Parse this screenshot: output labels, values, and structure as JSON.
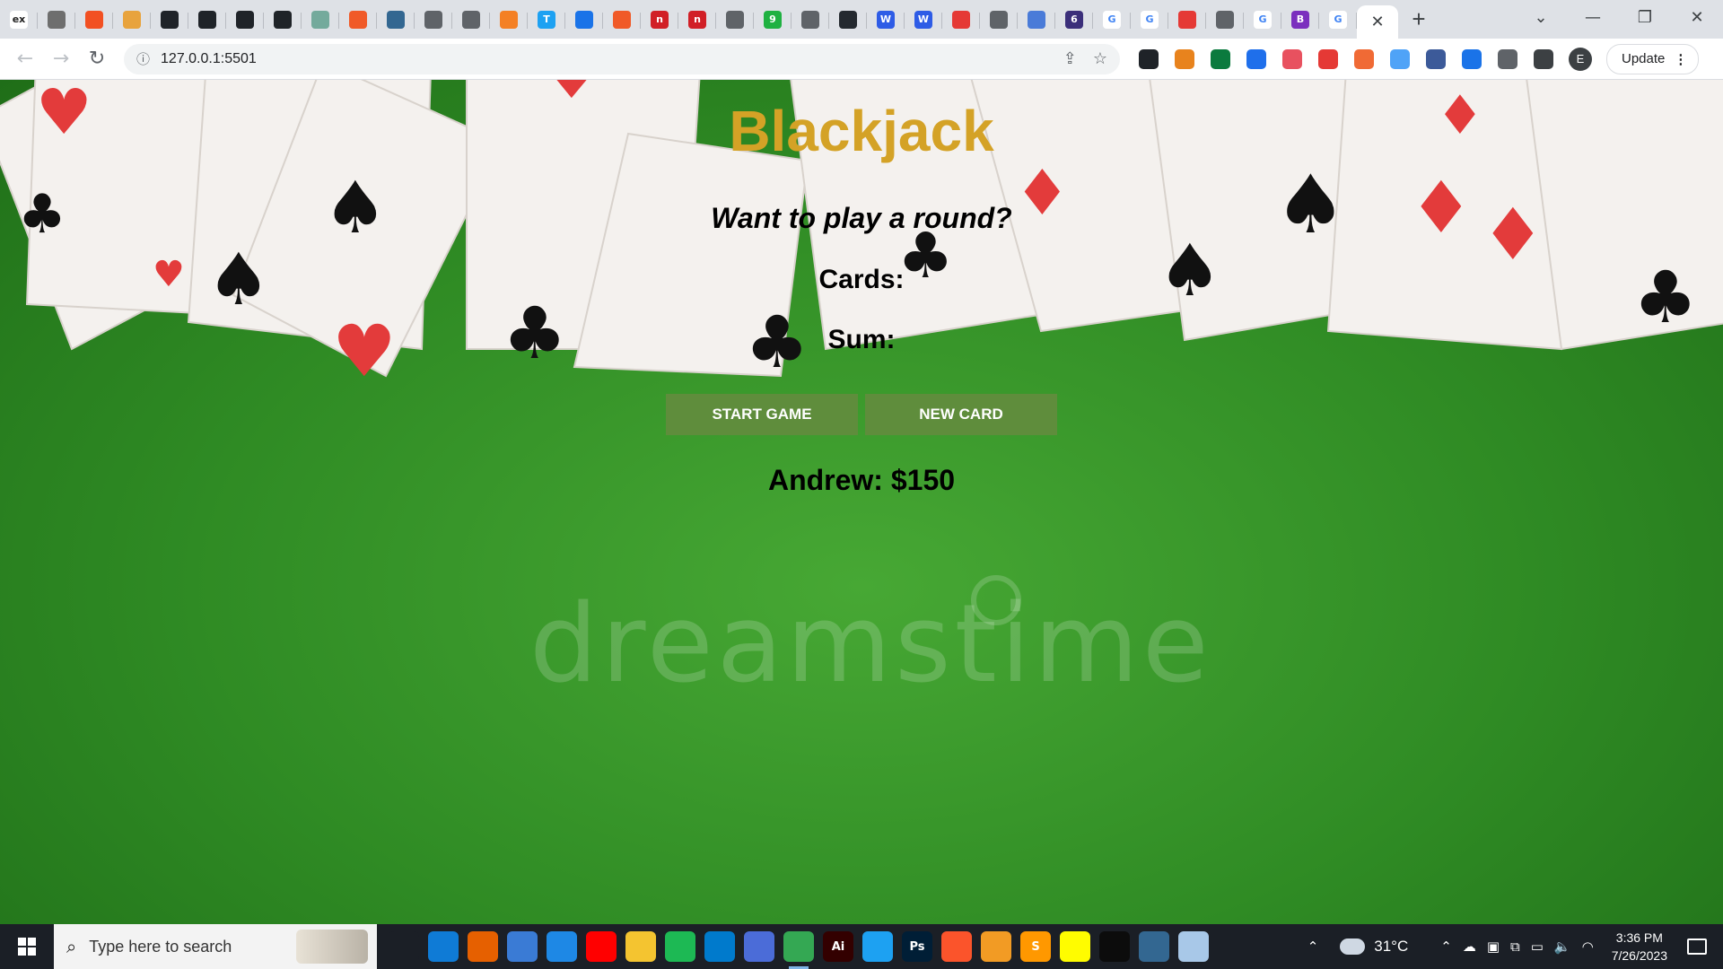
{
  "browser": {
    "tab_favicons": [
      {
        "icon": "ex-icon",
        "label": "ex",
        "color": "#ffffff",
        "text": "#222"
      },
      {
        "icon": "hexagon-icon",
        "label": "",
        "color": "#6e6e6e",
        "text": "#fff"
      },
      {
        "icon": "microsoft-icon",
        "label": "",
        "color": "#f25022",
        "text": "#fff"
      },
      {
        "icon": "fox-icon",
        "label": "",
        "color": "#e8a33d",
        "text": "#fff"
      },
      {
        "icon": "leaf-icon",
        "label": "",
        "color": "#1f2328",
        "text": "#fff"
      },
      {
        "icon": "leaf-icon",
        "label": "",
        "color": "#1f2328",
        "text": "#fff"
      },
      {
        "icon": "leaf-icon",
        "label": "",
        "color": "#1f2328",
        "text": "#fff"
      },
      {
        "icon": "leaf-icon",
        "label": "",
        "color": "#1f2328",
        "text": "#fff"
      },
      {
        "icon": "openai-icon",
        "label": "",
        "color": "#74aa9c",
        "text": "#fff"
      },
      {
        "icon": "codepen-icon",
        "label": "",
        "color": "#f05a28",
        "text": "#fff"
      },
      {
        "icon": "postgres-icon",
        "label": "",
        "color": "#336791",
        "text": "#fff"
      },
      {
        "icon": "globe-icon",
        "label": "",
        "color": "#5f6368",
        "text": "#fff"
      },
      {
        "icon": "globe-icon",
        "label": "",
        "color": "#5f6368",
        "text": "#fff"
      },
      {
        "icon": "stackoverflow-icon",
        "label": "",
        "color": "#f48024",
        "text": "#fff"
      },
      {
        "icon": "t-icon",
        "label": "T",
        "color": "#1da1f2",
        "text": "#fff"
      },
      {
        "icon": "download-icon",
        "label": "",
        "color": "#1a73e8",
        "text": "#fff"
      },
      {
        "icon": "codepen-icon",
        "label": "",
        "color": "#f05a28",
        "text": "#fff"
      },
      {
        "icon": "n-icon",
        "label": "n",
        "color": "#d11f26",
        "text": "#fff"
      },
      {
        "icon": "n-icon",
        "label": "n",
        "color": "#d11f26",
        "text": "#fff"
      },
      {
        "icon": "globe-icon",
        "label": "",
        "color": "#5f6368",
        "text": "#fff"
      },
      {
        "icon": "nine-icon",
        "label": "9",
        "color": "#1fb141",
        "text": "#fff"
      },
      {
        "icon": "globe-icon",
        "label": "",
        "color": "#5f6368",
        "text": "#fff"
      },
      {
        "icon": "github-icon",
        "label": "",
        "color": "#24292f",
        "text": "#fff"
      },
      {
        "icon": "w-icon",
        "label": "W",
        "color": "#2e5ce6",
        "text": "#fff"
      },
      {
        "icon": "w-icon",
        "label": "W",
        "color": "#2e5ce6",
        "text": "#fff"
      },
      {
        "icon": "red-app-icon",
        "label": "",
        "color": "#e53935",
        "text": "#fff"
      },
      {
        "icon": "globe-icon",
        "label": "",
        "color": "#5f6368",
        "text": "#fff"
      },
      {
        "icon": "flag-icon",
        "label": "",
        "color": "#4a7bd8",
        "text": "#fff"
      },
      {
        "icon": "six-icon",
        "label": "6",
        "color": "#3b2f7a",
        "text": "#fff"
      },
      {
        "icon": "google-icon",
        "label": "G",
        "color": "#ffffff",
        "text": "#4285f4"
      },
      {
        "icon": "google-icon",
        "label": "G",
        "color": "#ffffff",
        "text": "#4285f4"
      },
      {
        "icon": "bug-icon",
        "label": "",
        "color": "#e53935",
        "text": "#fff"
      },
      {
        "icon": "globe-icon",
        "label": "",
        "color": "#5f6368",
        "text": "#fff"
      },
      {
        "icon": "google-icon",
        "label": "G",
        "color": "#ffffff",
        "text": "#4285f4"
      },
      {
        "icon": "b-icon",
        "label": "B",
        "color": "#7b2fbe",
        "text": "#fff"
      },
      {
        "icon": "google-icon",
        "label": "G",
        "color": "#ffffff",
        "text": "#4285f4"
      }
    ],
    "active_tab_close": "✕",
    "new_tab": "+",
    "window_controls": {
      "dropdown": "⌄",
      "minimize": "—",
      "restore": "❐",
      "close": "✕"
    },
    "url": "127.0.0.1:5501",
    "update_label": "Update",
    "profile_initial": "E",
    "extensions": [
      {
        "icon": "sparkle-icon",
        "color": "#1f2328"
      },
      {
        "icon": "metamask-icon",
        "color": "#e8831d"
      },
      {
        "icon": "gear-grid-icon",
        "color": "#0b7a3e"
      },
      {
        "icon": "n-ext-icon",
        "color": "#1f6feb"
      },
      {
        "icon": "p-ext-icon",
        "color": "#e8515f"
      },
      {
        "icon": "lock-icon",
        "color": "#e53935"
      },
      {
        "icon": "a-ext-icon",
        "color": "#f06a35"
      },
      {
        "icon": "drop-icon",
        "color": "#4fa3f7"
      },
      {
        "icon": "v-ext-icon",
        "color": "#3c5a99"
      },
      {
        "icon": "circle-ext-icon",
        "color": "#1a73e8"
      },
      {
        "icon": "puzzle-icon",
        "color": "#5f6368"
      },
      {
        "icon": "sidepanel-icon",
        "color": "#3c4043"
      }
    ]
  },
  "game": {
    "title": "Blackjack",
    "message": "Want to play a round?",
    "cards_label": "Cards:",
    "sum_label": "Sum:",
    "start_button": "START GAME",
    "new_card_button": "NEW CARD",
    "player": "Andrew: $150",
    "watermark": "dreamstime",
    "title_color": "#d4a226",
    "button_color": "#5f8d3c"
  },
  "taskbar": {
    "search_placeholder": "Type here to search",
    "apps": [
      {
        "icon": "task-view-icon",
        "label": "",
        "color": "#1b1f26"
      },
      {
        "icon": "edge-icon",
        "label": "",
        "color": "#0f7bd6"
      },
      {
        "icon": "firefox-icon",
        "label": "",
        "color": "#e66000"
      },
      {
        "icon": "store-icon",
        "label": "",
        "color": "#3a7bd5"
      },
      {
        "icon": "mail-icon",
        "label": "",
        "color": "#1e88e5"
      },
      {
        "icon": "youtube-icon",
        "label": "",
        "color": "#ff0000"
      },
      {
        "icon": "folder-icon",
        "label": "",
        "color": "#f4c430"
      },
      {
        "icon": "spotify-icon",
        "label": "",
        "color": "#1db954"
      },
      {
        "icon": "vscode-icon",
        "label": "",
        "color": "#007acc"
      },
      {
        "icon": "app-icon",
        "label": "",
        "color": "#4b6cd8"
      },
      {
        "icon": "chrome-icon",
        "label": "",
        "color": "#34a853"
      },
      {
        "icon": "illustrator-icon",
        "label": "Ai",
        "color": "#330000"
      },
      {
        "icon": "twitter-icon",
        "label": "",
        "color": "#1da1f2"
      },
      {
        "icon": "photoshop-icon",
        "label": "Ps",
        "color": "#001e36"
      },
      {
        "icon": "brave-icon",
        "label": "",
        "color": "#fb542b"
      },
      {
        "icon": "fl-studio-icon",
        "label": "",
        "color": "#f29b24"
      },
      {
        "icon": "sublime-icon",
        "label": "S",
        "color": "#ff9800"
      },
      {
        "icon": "snapchat-icon",
        "label": "",
        "color": "#fffc00"
      },
      {
        "icon": "terminal-icon",
        "label": "",
        "color": "#0c0c0c"
      },
      {
        "icon": "postgres-icon",
        "label": "",
        "color": "#336791"
      },
      {
        "icon": "app-icon",
        "label": "",
        "color": "#a8c8e8"
      }
    ],
    "weather": "31°C",
    "time": "3:36 PM",
    "date": "7/26/2023"
  }
}
